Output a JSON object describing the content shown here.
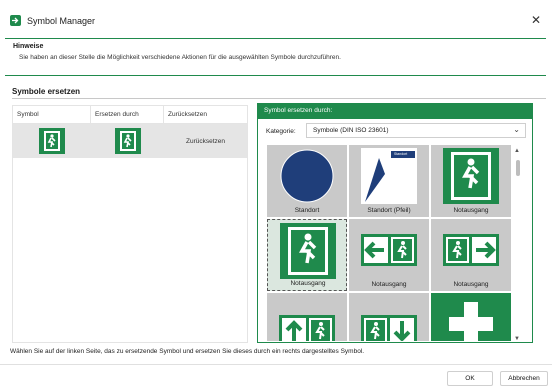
{
  "window": {
    "title": "Symbol Manager",
    "close_icon": "close-icon",
    "accent_color": "#1f8a4c"
  },
  "hinweise": {
    "title": "Hinweise",
    "text": "Sie haben an dieser Stelle die Möglichkeit verschiedene Aktionen für die ausgewählten Symbole durchzuführen."
  },
  "replace_section": {
    "title": "Symbole ersetzen",
    "columns": [
      "Symbol",
      "Ersetzen durch",
      "Zurücksetzen"
    ],
    "rows": [
      {
        "symbol_icon": "emergency-exit-icon",
        "replace_icon": "emergency-exit-icon",
        "reset_label": "Zurücksetzen"
      }
    ]
  },
  "replace_panel": {
    "header": "Symbol ersetzen durch:",
    "category_label": "Kategorie:",
    "category_value": "Symbole (DIN ISO 23601)",
    "tiles": [
      {
        "label": "Standort",
        "icon": "standort-icon"
      },
      {
        "label": "Standort (Pfeil)",
        "icon": "standort-arrow-icon",
        "badge": "Standort"
      },
      {
        "label": "Notausgang",
        "icon": "emergency-exit-icon"
      },
      {
        "label": "Notausgang",
        "icon": "emergency-exit-icon",
        "selected": true
      },
      {
        "label": "Notausgang",
        "icon": "emergency-exit-left-icon"
      },
      {
        "label": "Notausgang",
        "icon": "emergency-exit-right-icon"
      },
      {
        "label": "",
        "icon": "emergency-exit-up-icon"
      },
      {
        "label": "",
        "icon": "emergency-exit-down-icon"
      },
      {
        "label": "",
        "icon": "first-aid-icon"
      }
    ]
  },
  "footer": {
    "hint": "Wählen Sie auf der linken Seite, das zu ersetzende Symbol und ersetzen Sie dieses durch ein rechts dargestelltes Symbol.",
    "ok_label": "OK",
    "cancel_label": "Abbrechen"
  }
}
